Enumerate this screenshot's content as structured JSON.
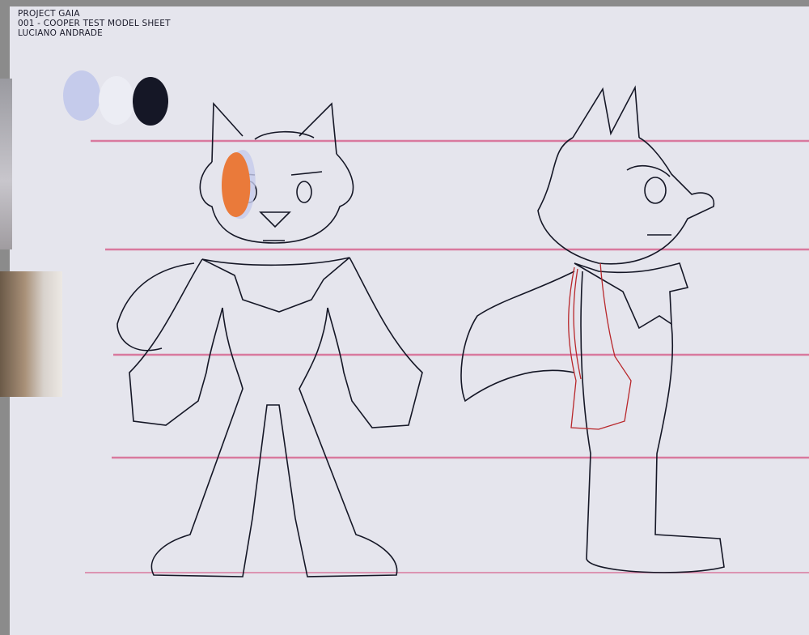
{
  "sheet_text": {
    "line1": "PROJECT GAIA",
    "line2": "001 - COOPER TEST MODEL SHEET",
    "line3": "LUCIANO ANDRADE"
  },
  "palette": [
    "#c5cbeb",
    "#ecedf4",
    "#151726"
  ],
  "colors": {
    "guide_lines": "#d9799e",
    "canvas": "#e5e5ed",
    "accent_patch": "#ea7a3a",
    "sketch_red": "#b8272b",
    "line_art": "#151726"
  }
}
